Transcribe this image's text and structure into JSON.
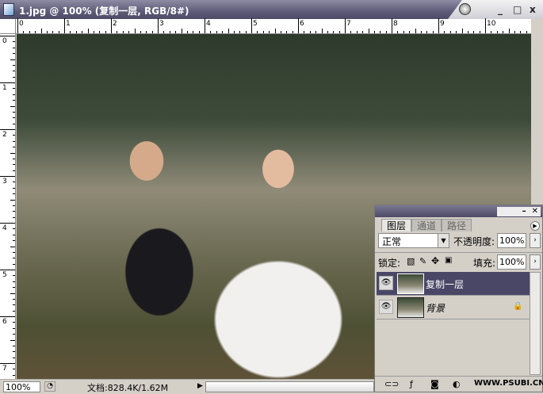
{
  "window": {
    "title": "1.jpg @ 100% (复制一层, RGB/8#)",
    "minimize": "_",
    "maximize": "□",
    "close": "x"
  },
  "ruler": {
    "h_labels": [
      "0",
      "1",
      "2",
      "3",
      "4",
      "5",
      "6",
      "7",
      "8",
      "9",
      "10"
    ],
    "v_labels": [
      "0",
      "1",
      "2",
      "3",
      "4",
      "5",
      "6",
      "7"
    ]
  },
  "status": {
    "zoom": "100%",
    "doc_info": "文档:828.4K/1.62M"
  },
  "layers_panel": {
    "tabs": [
      {
        "label": "图层",
        "active": true
      },
      {
        "label": "通道"
      },
      {
        "label": "路径"
      }
    ],
    "blend_mode": "正常",
    "opacity_label": "不透明度:",
    "opacity": "100%",
    "lock_label": "锁定:",
    "fill_label": "填充:",
    "fill": "100%",
    "layers": [
      {
        "name": "复制一层",
        "selected": true
      },
      {
        "name": "背景",
        "locked": true
      }
    ],
    "watermark": "WWW.PSUBI.CN"
  }
}
